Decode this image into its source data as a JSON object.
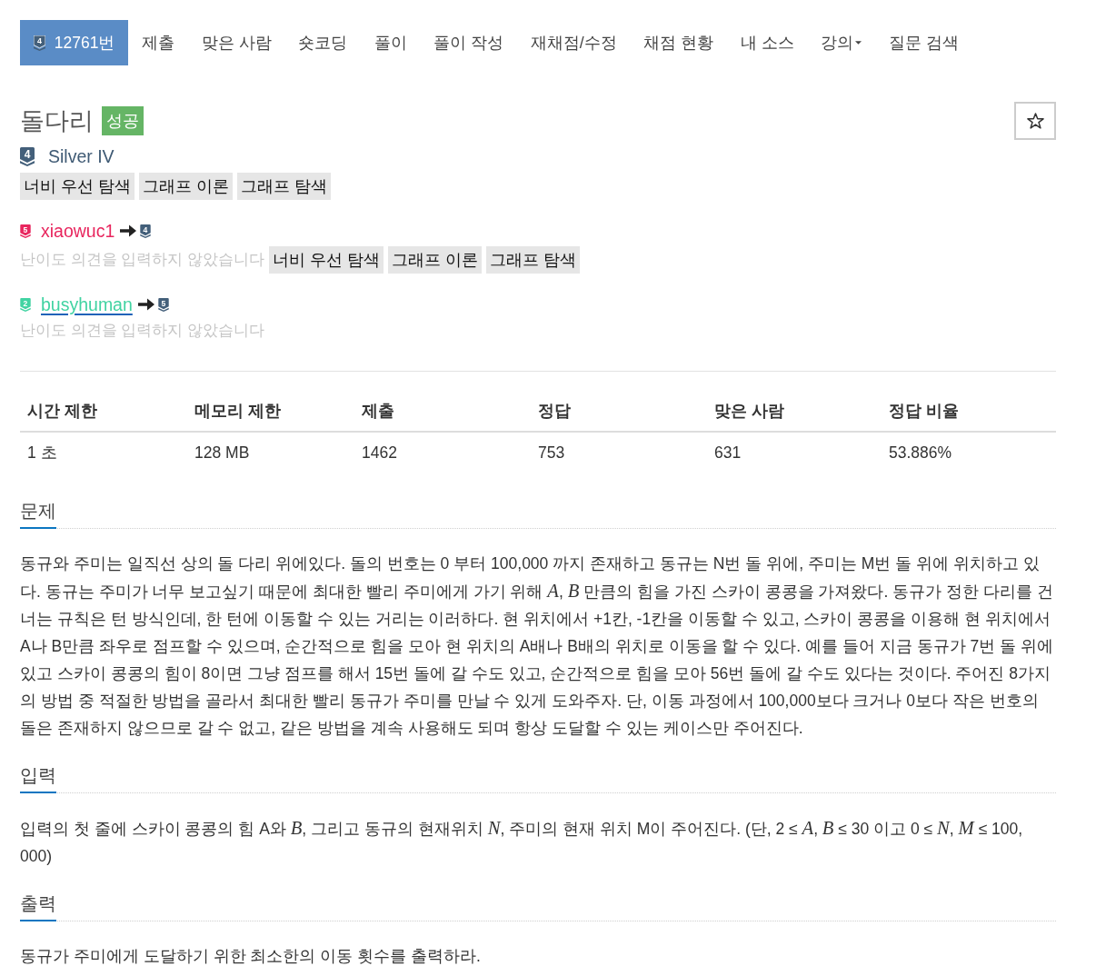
{
  "nav": {
    "items": [
      {
        "label": "12761번",
        "badge": "4",
        "selected": true,
        "dropdown": false
      },
      {
        "label": "제출",
        "selected": false,
        "dropdown": false
      },
      {
        "label": "맞은 사람",
        "selected": false,
        "dropdown": false
      },
      {
        "label": "숏코딩",
        "selected": false,
        "dropdown": false
      },
      {
        "label": "풀이",
        "selected": false,
        "dropdown": false
      },
      {
        "label": "풀이 작성",
        "selected": false,
        "dropdown": false
      },
      {
        "label": "재채점/수정",
        "selected": false,
        "dropdown": false
      },
      {
        "label": "채점 현황",
        "selected": false,
        "dropdown": false
      },
      {
        "label": "내 소스",
        "selected": false,
        "dropdown": false
      },
      {
        "label": "강의",
        "selected": false,
        "dropdown": true
      },
      {
        "label": "질문 검색",
        "selected": false,
        "dropdown": false
      }
    ]
  },
  "problem": {
    "title": "돌다리",
    "result": "성공",
    "starred": false,
    "tier": {
      "badge": "4",
      "label": "Silver IV"
    },
    "tags": [
      "너비 우선 탐색",
      "그래프 이론",
      "그래프 탐색"
    ]
  },
  "opinions": [
    {
      "user": "xiaowuc1",
      "badge": "5",
      "color": "#e8265e",
      "underlined": false,
      "to": {
        "badge": "4"
      },
      "note": "난이도 의견을 입력하지 않았습니다",
      "tags": [
        "너비 우선 탐색",
        "그래프 이론",
        "그래프 탐색"
      ]
    },
    {
      "user": "busyhuman",
      "badge": "2",
      "color": "#41d3a2",
      "underlined": true,
      "to": {
        "badge": "5"
      },
      "note": "난이도 의견을 입력하지 않았습니다"
    }
  ],
  "stats": {
    "columns": [
      "시간 제한",
      "메모리 제한",
      "제출",
      "정답",
      "맞은 사람",
      "정답 비율"
    ],
    "rows": [
      [
        "1 초",
        "128 MB",
        "1462",
        "753",
        "631",
        "53.886%"
      ]
    ]
  },
  "sections": [
    {
      "heading": "문제",
      "paragraphs": [
        "동규와 주미는 일직선 상의 돌 다리 위에있다. 돌의 번호는 0 부터 100,000 까지 존재하고 동규는 N번 돌 위에, 주미는 M번 돌 위에 위치하고 있다. 동규는 주미가 너무 보고싶기 때문에 최대한 빨리 주미에게 가기 위해 *A*, *B* 만큼의 힘을 가진 스카이 콩콩을 가져왔다. 동규가 정한 다리를 건너는 규칙은 턴 방식인데, 한 턴에 이동할 수 있는 거리는 이러하다. 현 위치에서 +1칸, -1칸을 이동할 수 있고, 스카이 콩콩을 이용해 현 위치에서 A나 B만큼 좌우로 점프할 수 있으며, 순간적으로 힘을 모아 현 위치의 A배나 B배의 위치로 이동을 할 수 있다. 예를 들어 지금 동규가 7번 돌 위에 있고 스카이 콩콩의 힘이 8이면 그냥 점프를 해서 15번 돌에 갈 수도 있고, 순간적으로 힘을 모아 56번 돌에 갈 수도 있다는 것이다. 주어진 8가지의 방법 중 적절한 방법을 골라서 최대한 빨리 동규가 주미를 만날 수 있게 도와주자. 단, 이동 과정에서 100,000보다 크거나 0보다 작은 번호의 돌은 존재하지 않으므로 갈 수 없고, 같은 방법을 계속 사용해도 되며 항상 도달할 수 있는 케이스만 주어진다."
      ]
    },
    {
      "heading": "입력",
      "paragraphs": [
        "입력의 첫 줄에 스카이 콩콩의 힘 A와 *B*, 그리고 동규의 현재위치 *N*, 주미의 현재 위치 M이 주어진다. (단, 2 ≤ *A*, *B* ≤ 30 이고 0 ≤ *N*, *M* ≤ 100, 000)"
      ]
    },
    {
      "heading": "출력",
      "paragraphs": [
        "동규가 주미에게 도달하기 위한 최소한의 이동 횟수를 출력하라."
      ]
    }
  ]
}
